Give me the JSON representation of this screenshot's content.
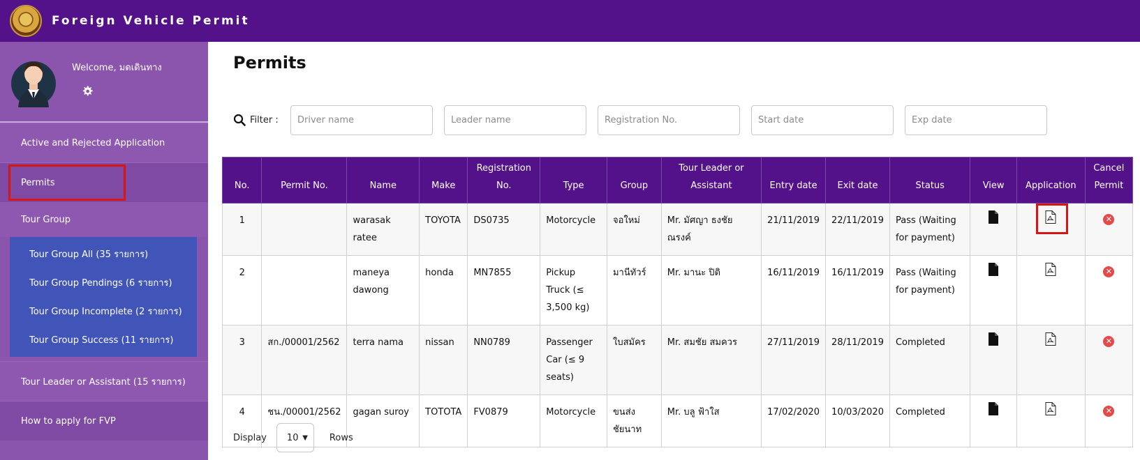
{
  "app": {
    "title": "Foreign Vehicle Permit"
  },
  "profile": {
    "welcome": "Welcome, มดเดินทาง"
  },
  "sidebar": {
    "items": [
      {
        "label": "Active and Rejected Application"
      },
      {
        "label": "Permits"
      },
      {
        "label": "Tour Group"
      },
      {
        "label": "Tour Leader or Assistant (15 รายการ)"
      },
      {
        "label": "How to apply for FVP"
      }
    ],
    "tour_group": [
      {
        "label": "Tour Group All (35 รายการ)"
      },
      {
        "label": "Tour Group Pendings (6 รายการ)"
      },
      {
        "label": "Tour Group Incomplete (2 รายการ)"
      },
      {
        "label": "Tour Group Success (11 รายการ)"
      }
    ]
  },
  "page": {
    "title": "Permits"
  },
  "filter": {
    "label": "Filter :",
    "placeholders": [
      "Driver name",
      "Leader name",
      "Registration No.",
      "Start date",
      "Exp date"
    ]
  },
  "table": {
    "headers": [
      "No.",
      "Permit No.",
      "Name",
      "Make",
      "Registration No.",
      "Type",
      "Group",
      "Tour Leader or Assistant",
      "Entry date",
      "Exit date",
      "Status",
      "View",
      "Application",
      "Cancel Permit"
    ],
    "rows": [
      {
        "no": "1",
        "permit": "",
        "name": "warasak ratee",
        "make": "TOYOTA",
        "reg": "DS0735",
        "type": "Motorcycle",
        "group": "จอใหม่",
        "leader": "Mr. มัศญา ธงชัยณรงค์",
        "entry": "21/11/2019",
        "exit": "22/11/2019",
        "status": "Pass (Waiting for payment)"
      },
      {
        "no": "2",
        "permit": "",
        "name": "maneya dawong",
        "make": "honda",
        "reg": "MN7855",
        "type": "Pickup Truck (≤ 3,500 kg)",
        "group": "มานีทัวร์",
        "leader": "Mr. มานะ ปิติ",
        "entry": "16/11/2019",
        "exit": "16/11/2019",
        "status": "Pass (Waiting for payment)"
      },
      {
        "no": "3",
        "permit": "สก./00001/2562",
        "name": "terra nama",
        "make": "nissan",
        "reg": "NN0789",
        "type": "Passenger Car (≤ 9 seats)",
        "group": "ใบสมัคร",
        "leader": "Mr. สมชัย สมควร",
        "entry": "27/11/2019",
        "exit": "28/11/2019",
        "status": "Completed"
      },
      {
        "no": "4",
        "permit": "ชน./00001/2562",
        "name": "gagan suroy",
        "make": "TOTOTA",
        "reg": "FV0879",
        "type": "Motorcycle",
        "group": "ขนส่ง ชัยนาท",
        "leader": "Mr. บลู ฟ้าใส",
        "entry": "17/02/2020",
        "exit": "10/03/2020",
        "status": "Completed"
      }
    ]
  },
  "footer": {
    "display_label": "Display",
    "rows_value": "10",
    "rows_label": "Rows"
  },
  "colors": {
    "header": "#54128a",
    "sidebar": "#8a55ad",
    "tour_group": "#4155b8",
    "highlight": "#d51616"
  }
}
